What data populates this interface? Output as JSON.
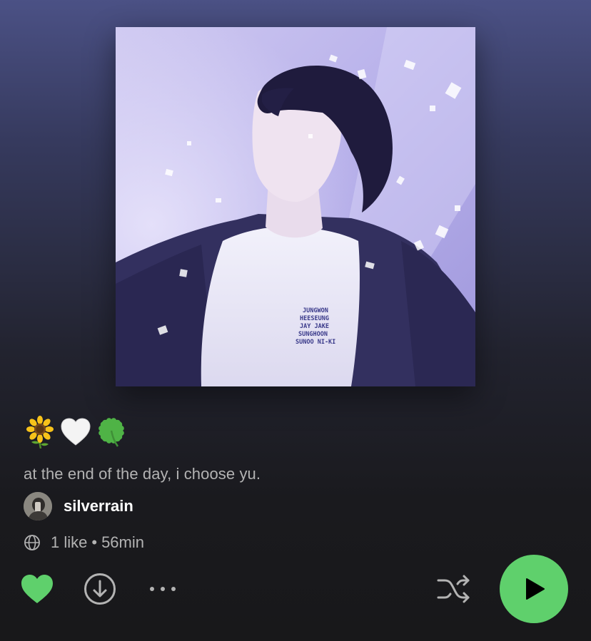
{
  "playlist": {
    "title_emojis": [
      "sunflower-icon",
      "white-heart-icon",
      "four-leaf-clover-icon"
    ],
    "description": "at the end of the day, i choose yu.",
    "owner": "silverrain",
    "likes_text": "1 like",
    "separator": "•",
    "duration": "56min"
  },
  "cover": {
    "shirt_text": [
      "JUNGWON",
      "HEESEUNG",
      "JAY JAKE",
      "SUNGHOON",
      "SUNOO NI-KI"
    ]
  },
  "actions": {
    "like_icon": "heart-filled-icon",
    "download_icon": "download-circle-icon",
    "more_icon": "more-horizontal-icon",
    "shuffle_icon": "shuffle-icon",
    "play_icon": "play-icon"
  },
  "colors": {
    "accent_green": "#5fd06c",
    "text_secondary": "#b3b3b3",
    "text_primary": "#ffffff"
  }
}
